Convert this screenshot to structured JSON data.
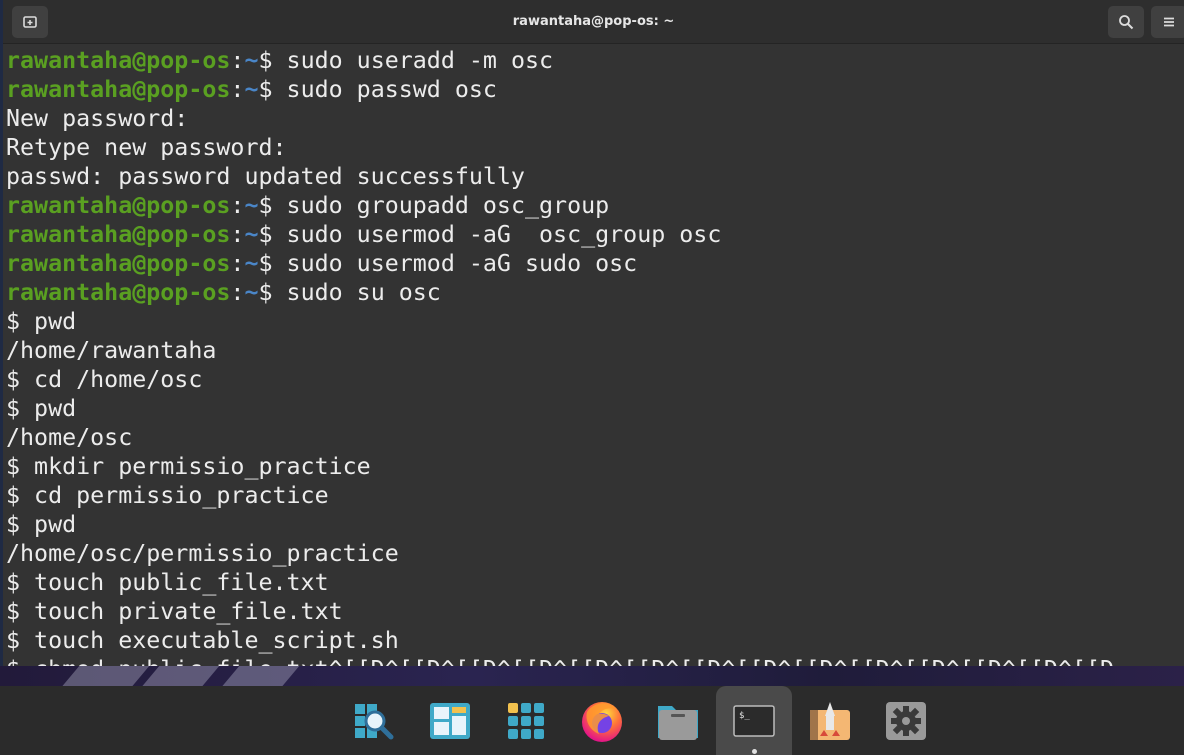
{
  "window": {
    "title": "rawantaha@pop-os: ~"
  },
  "prompt": {
    "user": "rawantaha@pop-os",
    "colon": ":",
    "dir": "~",
    "symbol": "$ "
  },
  "terminal_lines": [
    {
      "type": "prompt",
      "cmd": "sudo useradd -m osc"
    },
    {
      "type": "prompt",
      "cmd": "sudo passwd osc"
    },
    {
      "type": "output",
      "text": "New password:"
    },
    {
      "type": "output",
      "text": "Retype new password:"
    },
    {
      "type": "output",
      "text": "passwd: password updated successfully"
    },
    {
      "type": "prompt",
      "cmd": "sudo groupadd osc_group"
    },
    {
      "type": "prompt",
      "cmd": "sudo usermod -aG  osc_group osc"
    },
    {
      "type": "prompt",
      "cmd": "sudo usermod -aG sudo osc"
    },
    {
      "type": "prompt",
      "cmd": "sudo su osc"
    },
    {
      "type": "output",
      "text": "$ pwd"
    },
    {
      "type": "output",
      "text": "/home/rawantaha"
    },
    {
      "type": "output",
      "text": "$ cd /home/osc"
    },
    {
      "type": "output",
      "text": "$ pwd"
    },
    {
      "type": "output",
      "text": "/home/osc"
    },
    {
      "type": "output",
      "text": "$ mkdir permissio_practice"
    },
    {
      "type": "output",
      "text": "$ cd permissio_practice"
    },
    {
      "type": "output",
      "text": "$ pwd"
    },
    {
      "type": "output",
      "text": "/home/osc/permissio_practice"
    },
    {
      "type": "output",
      "text": "$ touch public_file.txt"
    },
    {
      "type": "output",
      "text": "$ touch private_file.txt"
    },
    {
      "type": "output",
      "text": "$ touch executable_script.sh"
    },
    {
      "type": "output",
      "text": "$ chmod public_file.txt^[[D^[[D^[[D^[[D^[[D^[[D^[[D^[[D^[[D^[[D^[[D^[[D^[[D^[[D"
    }
  ],
  "dock": {
    "items": [
      {
        "icon": "search-launcher-icon",
        "active": false
      },
      {
        "icon": "workspaces-icon",
        "active": false
      },
      {
        "icon": "app-grid-icon",
        "active": false
      },
      {
        "icon": "firefox-icon",
        "active": false
      },
      {
        "icon": "files-icon",
        "active": false
      },
      {
        "icon": "terminal-icon",
        "active": true
      },
      {
        "icon": "pop-shop-icon",
        "active": false
      },
      {
        "icon": "settings-icon",
        "active": false
      }
    ]
  },
  "colors": {
    "user": "#5aa021",
    "dir": "#4a86c8",
    "text": "#ececec",
    "background": "#333333"
  }
}
